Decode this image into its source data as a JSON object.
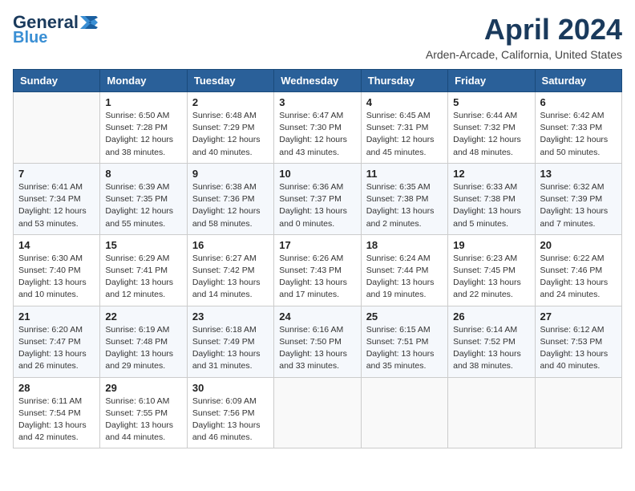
{
  "header": {
    "logo_line1": "General",
    "logo_line2": "Blue",
    "month_title": "April 2024",
    "location": "Arden-Arcade, California, United States"
  },
  "weekdays": [
    "Sunday",
    "Monday",
    "Tuesday",
    "Wednesday",
    "Thursday",
    "Friday",
    "Saturday"
  ],
  "weeks": [
    [
      {
        "day": "",
        "info": ""
      },
      {
        "day": "1",
        "info": "Sunrise: 6:50 AM\nSunset: 7:28 PM\nDaylight: 12 hours\nand 38 minutes."
      },
      {
        "day": "2",
        "info": "Sunrise: 6:48 AM\nSunset: 7:29 PM\nDaylight: 12 hours\nand 40 minutes."
      },
      {
        "day": "3",
        "info": "Sunrise: 6:47 AM\nSunset: 7:30 PM\nDaylight: 12 hours\nand 43 minutes."
      },
      {
        "day": "4",
        "info": "Sunrise: 6:45 AM\nSunset: 7:31 PM\nDaylight: 12 hours\nand 45 minutes."
      },
      {
        "day": "5",
        "info": "Sunrise: 6:44 AM\nSunset: 7:32 PM\nDaylight: 12 hours\nand 48 minutes."
      },
      {
        "day": "6",
        "info": "Sunrise: 6:42 AM\nSunset: 7:33 PM\nDaylight: 12 hours\nand 50 minutes."
      }
    ],
    [
      {
        "day": "7",
        "info": "Sunrise: 6:41 AM\nSunset: 7:34 PM\nDaylight: 12 hours\nand 53 minutes."
      },
      {
        "day": "8",
        "info": "Sunrise: 6:39 AM\nSunset: 7:35 PM\nDaylight: 12 hours\nand 55 minutes."
      },
      {
        "day": "9",
        "info": "Sunrise: 6:38 AM\nSunset: 7:36 PM\nDaylight: 12 hours\nand 58 minutes."
      },
      {
        "day": "10",
        "info": "Sunrise: 6:36 AM\nSunset: 7:37 PM\nDaylight: 13 hours\nand 0 minutes."
      },
      {
        "day": "11",
        "info": "Sunrise: 6:35 AM\nSunset: 7:38 PM\nDaylight: 13 hours\nand 2 minutes."
      },
      {
        "day": "12",
        "info": "Sunrise: 6:33 AM\nSunset: 7:38 PM\nDaylight: 13 hours\nand 5 minutes."
      },
      {
        "day": "13",
        "info": "Sunrise: 6:32 AM\nSunset: 7:39 PM\nDaylight: 13 hours\nand 7 minutes."
      }
    ],
    [
      {
        "day": "14",
        "info": "Sunrise: 6:30 AM\nSunset: 7:40 PM\nDaylight: 13 hours\nand 10 minutes."
      },
      {
        "day": "15",
        "info": "Sunrise: 6:29 AM\nSunset: 7:41 PM\nDaylight: 13 hours\nand 12 minutes."
      },
      {
        "day": "16",
        "info": "Sunrise: 6:27 AM\nSunset: 7:42 PM\nDaylight: 13 hours\nand 14 minutes."
      },
      {
        "day": "17",
        "info": "Sunrise: 6:26 AM\nSunset: 7:43 PM\nDaylight: 13 hours\nand 17 minutes."
      },
      {
        "day": "18",
        "info": "Sunrise: 6:24 AM\nSunset: 7:44 PM\nDaylight: 13 hours\nand 19 minutes."
      },
      {
        "day": "19",
        "info": "Sunrise: 6:23 AM\nSunset: 7:45 PM\nDaylight: 13 hours\nand 22 minutes."
      },
      {
        "day": "20",
        "info": "Sunrise: 6:22 AM\nSunset: 7:46 PM\nDaylight: 13 hours\nand 24 minutes."
      }
    ],
    [
      {
        "day": "21",
        "info": "Sunrise: 6:20 AM\nSunset: 7:47 PM\nDaylight: 13 hours\nand 26 minutes."
      },
      {
        "day": "22",
        "info": "Sunrise: 6:19 AM\nSunset: 7:48 PM\nDaylight: 13 hours\nand 29 minutes."
      },
      {
        "day": "23",
        "info": "Sunrise: 6:18 AM\nSunset: 7:49 PM\nDaylight: 13 hours\nand 31 minutes."
      },
      {
        "day": "24",
        "info": "Sunrise: 6:16 AM\nSunset: 7:50 PM\nDaylight: 13 hours\nand 33 minutes."
      },
      {
        "day": "25",
        "info": "Sunrise: 6:15 AM\nSunset: 7:51 PM\nDaylight: 13 hours\nand 35 minutes."
      },
      {
        "day": "26",
        "info": "Sunrise: 6:14 AM\nSunset: 7:52 PM\nDaylight: 13 hours\nand 38 minutes."
      },
      {
        "day": "27",
        "info": "Sunrise: 6:12 AM\nSunset: 7:53 PM\nDaylight: 13 hours\nand 40 minutes."
      }
    ],
    [
      {
        "day": "28",
        "info": "Sunrise: 6:11 AM\nSunset: 7:54 PM\nDaylight: 13 hours\nand 42 minutes."
      },
      {
        "day": "29",
        "info": "Sunrise: 6:10 AM\nSunset: 7:55 PM\nDaylight: 13 hours\nand 44 minutes."
      },
      {
        "day": "30",
        "info": "Sunrise: 6:09 AM\nSunset: 7:56 PM\nDaylight: 13 hours\nand 46 minutes."
      },
      {
        "day": "",
        "info": ""
      },
      {
        "day": "",
        "info": ""
      },
      {
        "day": "",
        "info": ""
      },
      {
        "day": "",
        "info": ""
      }
    ]
  ]
}
